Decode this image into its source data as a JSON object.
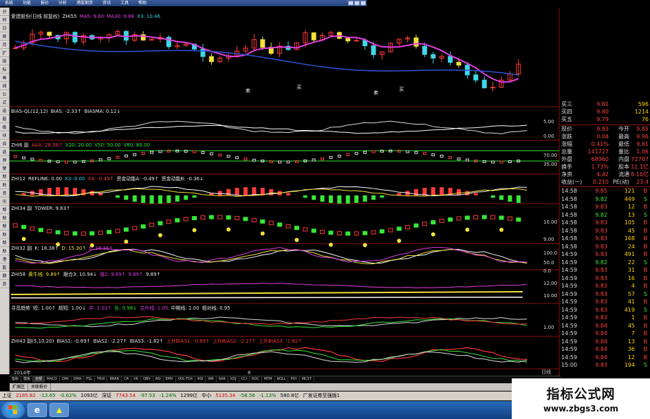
{
  "menu": {
    "items": [
      "系统",
      "功能",
      "报价",
      "分析",
      "港股期货",
      "资讯",
      "工具",
      "帮助"
    ]
  },
  "sidebar": {
    "items": [
      "分",
      "时",
      "日",
      "周",
      "月",
      "扩",
      "指",
      "标",
      "画",
      "线",
      "公",
      "式",
      "选",
      "股",
      "板",
      "块",
      "自",
      "选",
      "预",
      "警",
      "帮",
      "助",
      "资",
      "讯",
      "帮",
      "助",
      "帮",
      "助",
      "帮",
      "助",
      "港",
      "股",
      "期",
      "货"
    ]
  },
  "panes": [
    {
      "id": "main",
      "parts": [
        {
          "t": "爱建股份(日线 前复权)",
          "c": "w"
        },
        {
          "t": "ZHI55",
          "c": "w"
        },
        {
          "t": "MA5: 9.80",
          "c": "m"
        },
        {
          "t": "MA30: 9.88",
          "c": "m"
        },
        {
          "t": "X3: 10.46",
          "c": "c"
        }
      ]
    },
    {
      "id": "bias",
      "parts": [
        {
          "t": "BIAS-QL(12,12)",
          "c": "w"
        },
        {
          "t": "BIAS: -2.33↑",
          "c": "w"
        },
        {
          "t": "BIASMA: 0.12↓",
          "c": "w"
        }
      ]
    },
    {
      "id": "zhi6",
      "parts": [
        {
          "t": "ZHI6 副",
          "c": "w"
        },
        {
          "t": "AAA: 28.38↑",
          "c": "r"
        },
        {
          "t": "V20: 20.00",
          "c": "g"
        },
        {
          "t": "V50: 50.00",
          "c": "g"
        },
        {
          "t": "V80: 80.00",
          "c": "g"
        }
      ]
    },
    {
      "id": "zhi12",
      "parts": [
        {
          "t": "ZHI12",
          "c": "w"
        },
        {
          "t": "REFLINE: 0.00",
          "c": "w"
        },
        {
          "t": "X3: 0.00",
          "c": "c"
        },
        {
          "t": "X4: -0.49↑",
          "c": "r"
        },
        {
          "t": "资金动能A: -0.49↑",
          "c": "w"
        },
        {
          "t": "资金动能B: -0.36↓",
          "c": "w"
        }
      ]
    },
    {
      "id": "zhi34",
      "parts": [
        {
          "t": "ZHI34 副",
          "c": "w"
        },
        {
          "t": "TOWER: 9.83↑",
          "c": "w"
        }
      ]
    },
    {
      "id": "zhi32",
      "parts": [
        {
          "t": "ZHI32 副",
          "c": "w"
        },
        {
          "t": "K: 18.38↑",
          "c": "w"
        },
        {
          "t": "D: 15.30↑",
          "c": "y"
        },
        {
          "t": "E: 18.36↑",
          "c": "m"
        }
      ]
    },
    {
      "id": "zhi58",
      "parts": [
        {
          "t": "ZHI58",
          "c": "w"
        },
        {
          "t": "黄牛线: 9.89↑",
          "c": "y"
        },
        {
          "t": "跟合3: 10.94↓",
          "c": "w"
        },
        {
          "t": "值2: 9.89↑",
          "c": "m"
        },
        {
          "t": "9.89↑",
          "c": "m"
        },
        {
          "t": "9.89↑",
          "c": "w"
        }
      ]
    },
    {
      "id": "hd",
      "parts": [
        {
          "t": "寻觅趋势",
          "c": "w"
        },
        {
          "t": "短: 1.00↑",
          "c": "w"
        },
        {
          "t": "超短: 1.00↓",
          "c": "w"
        },
        {
          "t": "中: 1.03↑",
          "c": "m"
        },
        {
          "t": "长: 0.98↓",
          "c": "g"
        },
        {
          "t": "主升线: 1.05",
          "c": "m"
        },
        {
          "t": "中期线: 1.00",
          "c": "w"
        },
        {
          "t": "相对线: 0.95",
          "c": "w"
        }
      ]
    },
    {
      "id": "zhi43",
      "parts": [
        {
          "t": "ZHI43 副(5,10,20)",
          "c": "w"
        },
        {
          "t": "BIAS1: -0.69↑",
          "c": "w"
        },
        {
          "t": "BIAS2: -2.27↑",
          "c": "w"
        },
        {
          "t": "BIAS3: -1.82↑",
          "c": "w"
        },
        {
          "t": "上升BIAS1: -0.69↑",
          "c": "r"
        },
        {
          "t": "上升BIAS2: -2.27↑",
          "c": "r"
        },
        {
          "t": "上升BIAS3: -1.82↑",
          "c": "r"
        }
      ]
    }
  ],
  "markers": {
    "buy": "买",
    "sell": "卖",
    "year": "2014年",
    "month": "8"
  },
  "quote": {
    "book": [
      {
        "l": "买三",
        "v": "9.81",
        "q": "596"
      },
      {
        "l": "买四",
        "v": "9.80",
        "q": "1214"
      },
      {
        "l": "买五",
        "v": "9.79",
        "q": "76"
      }
    ],
    "stats": [
      {
        "l": "现价",
        "v": "9.83",
        "x": "今开",
        "y": "9.85"
      },
      {
        "l": "涨跌",
        "v": "0.04",
        "x": "最高",
        "y": "9.96"
      },
      {
        "l": "涨幅",
        "v": "0.41%",
        "x": "最低",
        "y": "9.61"
      },
      {
        "l": "总量",
        "v": "141727",
        "x": "量比",
        "y": "1.06"
      },
      {
        "l": "外盘",
        "v": "68960",
        "x": "内盘",
        "y": "72767"
      },
      {
        "l": "换手",
        "v": "1.73%",
        "x": "股本",
        "y": "11.1亿"
      },
      {
        "l": "净资",
        "v": "4.42",
        "x": "流通",
        "y": "8.16亿"
      },
      {
        "l": "收益(一)",
        "v": "0.210",
        "x": "PE(动)",
        "y": "23.4"
      }
    ],
    "ticks": [
      {
        "t": "14:58",
        "p": "9.85",
        "v": "121",
        "f": "B"
      },
      {
        "t": "14:58",
        "p": "9.82",
        "v": "449",
        "f": "S"
      },
      {
        "t": "14:58",
        "p": "9.83",
        "v": "12",
        "f": "B"
      },
      {
        "t": "14:58",
        "p": "9.82",
        "v": "13",
        "f": "S"
      },
      {
        "t": "14:58",
        "p": "9.83",
        "v": "105",
        "f": "B"
      },
      {
        "t": "14:58",
        "p": "9.83",
        "v": "45",
        "f": "B"
      },
      {
        "t": "14:58",
        "p": "9.83",
        "v": "168",
        "f": "B"
      },
      {
        "t": "14:58",
        "p": "9.83",
        "v": "24",
        "f": "B"
      },
      {
        "t": "14:59",
        "p": "9.83",
        "v": "491",
        "f": "B"
      },
      {
        "t": "14:59",
        "p": "9.82",
        "v": "22",
        "f": "S"
      },
      {
        "t": "14:59",
        "p": "9.83",
        "v": "31",
        "f": "B"
      },
      {
        "t": "14:59",
        "p": "9.83",
        "v": "16",
        "f": "B"
      },
      {
        "t": "14:59",
        "p": "9.83",
        "v": "4",
        "f": "B"
      },
      {
        "t": "14:59",
        "p": "9.83",
        "v": "57",
        "f": "S"
      },
      {
        "t": "14:59",
        "p": "9.83",
        "v": "41",
        "f": "B"
      },
      {
        "t": "14:59",
        "p": "9.83",
        "v": "419",
        "f": "S"
      },
      {
        "t": "14:59",
        "p": "9.83",
        "v": "1",
        "f": "B"
      },
      {
        "t": "14:59",
        "p": "9.84",
        "v": "45",
        "f": "B"
      },
      {
        "t": "14:59",
        "p": "9.84",
        "v": "7",
        "f": "B"
      },
      {
        "t": "14:59",
        "p": "9.84",
        "v": "13",
        "f": "B"
      },
      {
        "t": "14:59",
        "p": "9.84",
        "v": "36",
        "f": "B"
      },
      {
        "t": "14:59",
        "p": "9.84",
        "v": "12",
        "f": "B"
      },
      {
        "t": "15:00",
        "p": "9.83",
        "v": "194",
        "f": "S"
      }
    ],
    "riday": "日线"
  },
  "axis": {
    "bias": [
      "5.00",
      "0.00"
    ],
    "zhi6": [
      "70.00",
      "35.00"
    ],
    "zhi34": [
      "10.00",
      "9.00"
    ],
    "zhi32": [
      "100.0",
      "50.0",
      "0.0"
    ],
    "zhi58": [
      "12.00",
      "10.00"
    ],
    "hd": [
      "1.00"
    ]
  },
  "tabs": [
    "指标",
    "模板",
    "全部",
    "MACD",
    "DMI",
    "DMA",
    "FSL",
    "TRIX",
    "BRAR",
    "CR",
    "VR",
    "OBV",
    "ASI",
    "EMV",
    "VOL-TDX",
    "RSI",
    "WR",
    "SAR",
    "KDJ",
    "CCI",
    "ROC",
    "MTM",
    "BOLL",
    "PSY",
    "MCST"
  ],
  "subtabs": [
    "扩展区",
    "关联报价"
  ],
  "status": [
    {
      "t": "上证",
      "c": ""
    },
    {
      "t": "2185.82",
      "c": "r"
    },
    {
      "t": "-13.65",
      "c": "g"
    },
    {
      "t": "-0.62%",
      "c": "g"
    },
    {
      "t": "1093亿",
      "c": ""
    },
    {
      "t": "深证",
      "c": ""
    },
    {
      "t": "7743.54",
      "c": "r"
    },
    {
      "t": "-97.53",
      "c": "g"
    },
    {
      "t": "-1.24%",
      "c": "g"
    },
    {
      "t": "1299亿",
      "c": ""
    },
    {
      "t": "中小",
      "c": ""
    },
    {
      "t": "5135.34",
      "c": "r"
    },
    {
      "t": "-58.56",
      "c": "g"
    },
    {
      "t": "-1.13%",
      "c": "g"
    },
    {
      "t": "580.8亿",
      "c": ""
    },
    {
      "t": "广发证券至强版1",
      "c": ""
    }
  ],
  "watermark": {
    "line1": "指标公式网",
    "line2": "www.zbgs3.com"
  },
  "colors": {
    "up": "#ff3b3b",
    "down": "#36e836",
    "bg": "#000000",
    "grid": "#8b1010",
    "ma5": "#e33ee3",
    "x3": "#2f54d8",
    "accent": "#f4e13a"
  }
}
